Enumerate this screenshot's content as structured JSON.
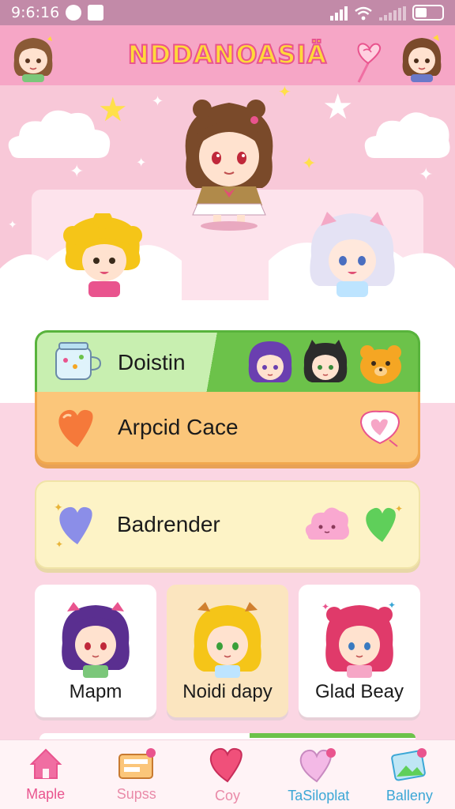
{
  "status_bar": {
    "time": "9:6:16"
  },
  "header": {
    "title": "NDDANOASIÄ"
  },
  "menu": [
    {
      "label": "Doistin",
      "color": "#6cc24a"
    },
    {
      "label": "Arpcid Cace",
      "color": "#fbc67a"
    },
    {
      "label": "Badrender",
      "color": "#fdf3c6"
    }
  ],
  "characters": [
    {
      "label": "Mapm"
    },
    {
      "label": "Noidi dapy"
    },
    {
      "label": "Glad Beay"
    }
  ],
  "nav": [
    {
      "label": "Maple",
      "color": "#e9548e",
      "icon": "home-icon"
    },
    {
      "label": "Supss",
      "color": "#e98aa8",
      "icon": "ticket-icon"
    },
    {
      "label": "Coy",
      "color": "#e98aa8",
      "icon": "heart-icon"
    },
    {
      "label": "TaSiloplat",
      "color": "#3ba7d6",
      "icon": "heart-badge-icon"
    },
    {
      "label": "Balleny",
      "color": "#3ba7d6",
      "icon": "gallery-icon"
    }
  ],
  "colors": {
    "accent": "#e9548e",
    "header": "#f6a6c6",
    "background": "#fbd6e3"
  }
}
